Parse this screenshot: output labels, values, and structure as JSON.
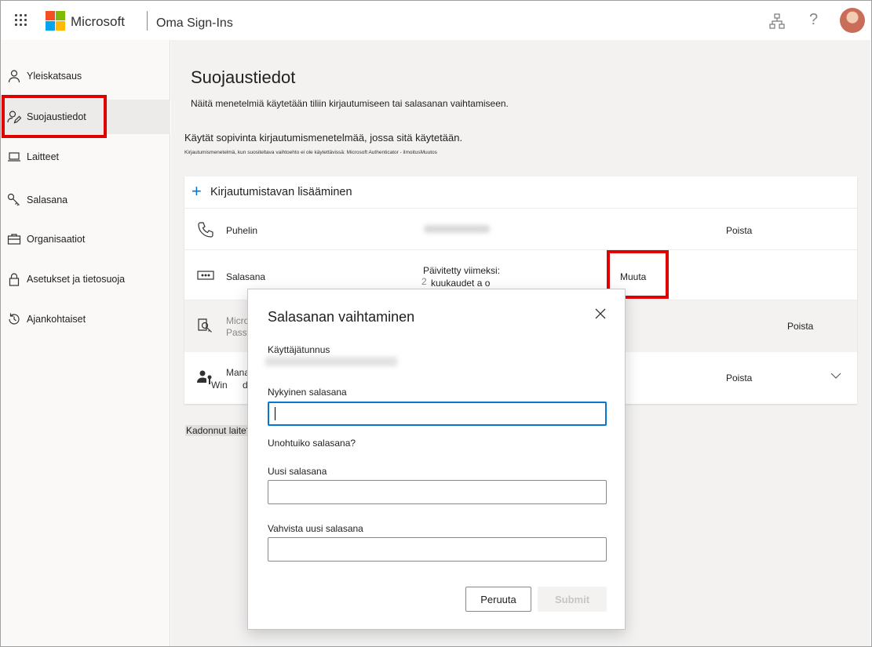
{
  "header": {
    "brand": "Microsoft",
    "app_title": "Oma Sign-Ins",
    "help_glyph": "?",
    "icons": [
      "waffle-icon",
      "microsoft-logo",
      "org-chart-icon",
      "help-icon",
      "avatar"
    ],
    "logo_colors": [
      "#f25022",
      "#7fba00",
      "#00a4ef",
      "#ffb900"
    ]
  },
  "sidebar": {
    "items": [
      {
        "label": "Yleiskatsaus",
        "icon": "person-icon"
      },
      {
        "label": "Suojaustiedot",
        "icon": "person-edit-icon",
        "active": true
      },
      {
        "label": "Laitteet",
        "icon": "laptop-icon"
      },
      {
        "label": "Salasana",
        "icon": "key-icon"
      },
      {
        "label": "Organisaatiot",
        "icon": "briefcase-icon"
      },
      {
        "label": "Asetukset ja tietosuoja",
        "icon": "lock-icon"
      },
      {
        "label": "Ajankohtaiset",
        "icon": "history-icon"
      }
    ]
  },
  "main": {
    "title": "Suojaustiedot",
    "description": "Näitä menetelmiä käytetään tiliin kirjautumiseen tai salasanan vaihtamiseen.",
    "default_method_text": "Käytät sopivinta kirjautumismenetelmää, jossa sitä käytetään.",
    "default_method_sub": "Kirjautumismenetelmä, kun suositeltava vaihtoehto ei ole käytettävissä: Microsoft Authenticator - ilmoitusMuutos",
    "add_method_label": "Kirjautumistavan lisääminen",
    "methods": [
      {
        "label": "Puhelin",
        "icon": "phone-icon",
        "action": "Poista"
      },
      {
        "label": "Salasana",
        "icon": "password-dots-icon",
        "updated_label": "Päivitetty viimeksi:",
        "updated_value": "2",
        "updated_value2": "kuukaudet a o",
        "action": "Muuta"
      },
      {
        "label": "Micro",
        "label2": "Passv",
        "icon": "security-key-icon",
        "action": "Poista"
      },
      {
        "label": "Mana",
        "label2": "Win",
        "label3": "d",
        "icon": "users-key-icon",
        "action": "Poista"
      }
    ],
    "lost_device_link": "Kadonnut laite?"
  },
  "dialog": {
    "title": "Salasanan vaihtaminen",
    "username_label": "Käyttäjätunnus",
    "current_password_label": "Nykyinen salasana",
    "forgot_password_link": "Unohtuiko salasana?",
    "new_password_label": "Uusi salasana",
    "confirm_password_label": "Vahvista uusi salasana",
    "cancel_button": "Peruuta",
    "submit_button": "Submit"
  },
  "colors": {
    "accent": "#0078d4",
    "highlight": "#e00000"
  }
}
